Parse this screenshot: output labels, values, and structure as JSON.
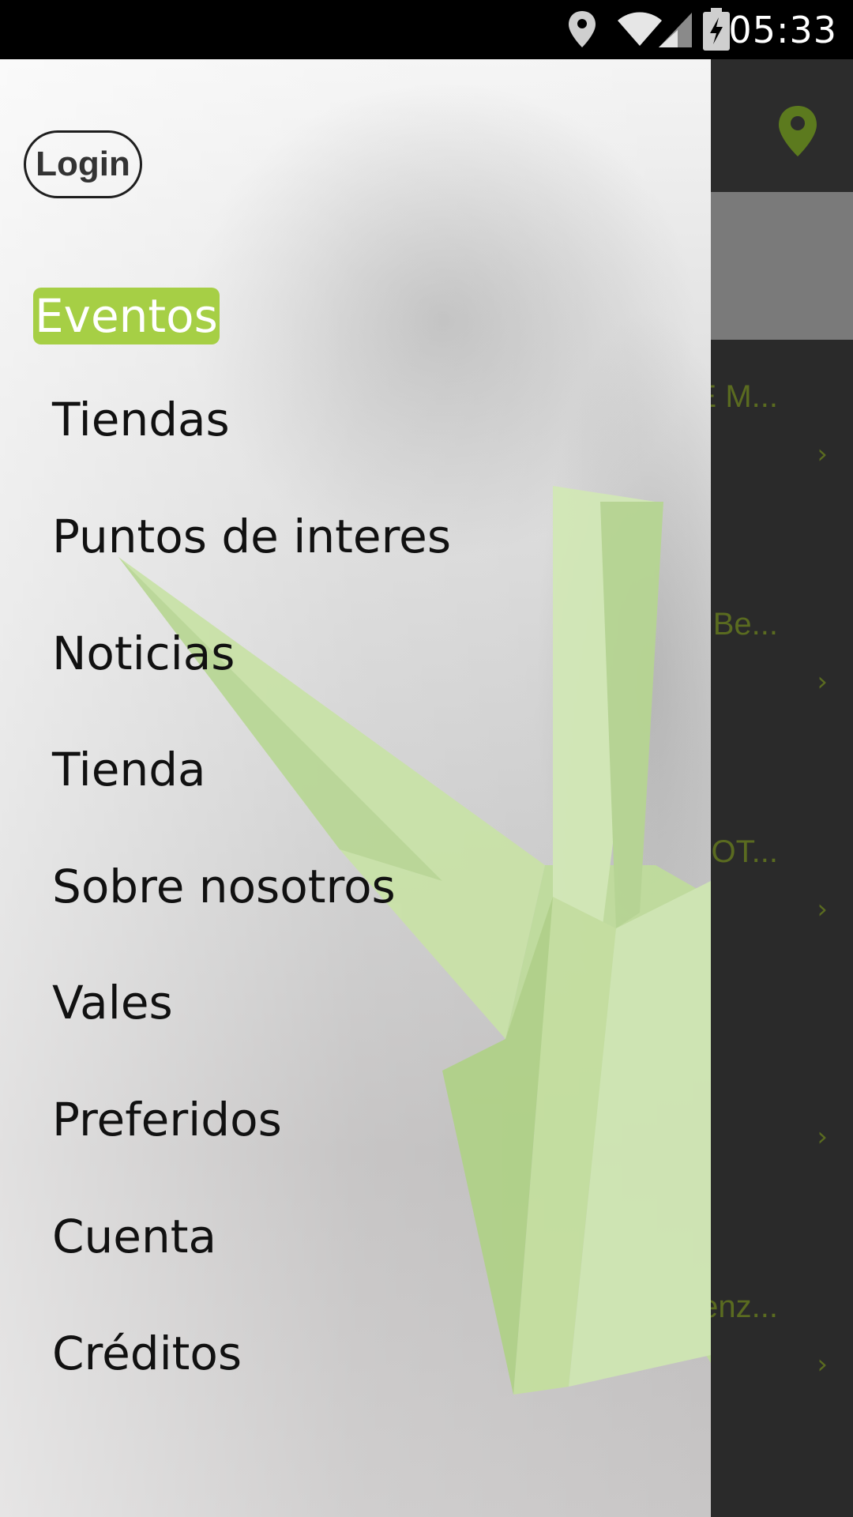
{
  "status_bar": {
    "time": "05:33",
    "icons": [
      "location-pin-icon",
      "wifi-icon",
      "signal-icon",
      "battery-charging-icon"
    ]
  },
  "colors": {
    "accent_green": "#a6cf45",
    "dark_green_text": "#5a6b20",
    "toolbar_bg": "#2c2c2c"
  },
  "drawer": {
    "login_label": "Login",
    "menu": [
      {
        "label": "Eventos",
        "active": true
      },
      {
        "label": "Tiendas",
        "active": false
      },
      {
        "label": "Puntos de interes",
        "active": false
      },
      {
        "label": "Noticias",
        "active": false
      },
      {
        "label": "Tienda",
        "active": false
      },
      {
        "label": "Sobre nosotros",
        "active": false
      },
      {
        "label": "Vales",
        "active": false
      },
      {
        "label": "Preferidos",
        "active": false
      },
      {
        "label": "Cuenta",
        "active": false
      },
      {
        "label": "Créditos",
        "active": false
      }
    ]
  },
  "background_app": {
    "toolbar_icon": "location-pin-icon",
    "list": [
      {
        "title_fragment": "E M...",
        "chevron": "›"
      },
      {
        "title_fragment": "Be...",
        "chevron": "›"
      },
      {
        "title_fragment": "OT...",
        "chevron": "›"
      },
      {
        "title_fragment": "",
        "chevron": "›"
      },
      {
        "title_fragment": "enz...",
        "chevron": "›"
      }
    ]
  }
}
